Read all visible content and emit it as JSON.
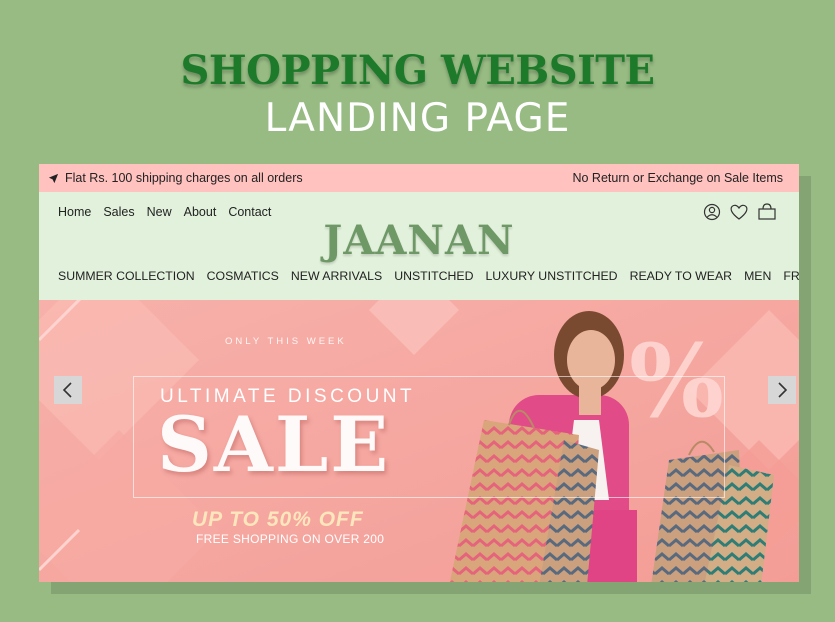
{
  "hero": {
    "title_line1": "SHOPPING WEBSITE",
    "title_line2": "LANDING PAGE"
  },
  "topbar": {
    "left_text": "Flat Rs. 100 shipping charges on all orders",
    "right_text": "No Return or Exchange on Sale Items"
  },
  "nav": {
    "links": [
      "Home",
      "Sales",
      "New",
      "About",
      "Contact"
    ]
  },
  "brand": {
    "name": "JAANAN"
  },
  "categories": [
    "SUMMER COLLECTION",
    "COSMATICS",
    "NEW ARRIVALS",
    "UNSTITCHED",
    "LUXURY UNSTITCHED",
    "READY TO WEAR",
    "MEN",
    "FRAGRANCES"
  ],
  "header_icons": [
    "user-icon",
    "heart-icon",
    "shopping-bag-icon"
  ],
  "banner": {
    "kicker": "ONLY THIS WEEK",
    "subtitle": "ULTIMATE DISCOUNT",
    "headline": "SALE",
    "offer": "UP TO 50% OFF",
    "note": "FREE SHOPPING ON OVER 200",
    "percent_sign": "%"
  },
  "colors": {
    "page_bg": "#97bb83",
    "title_green": "#1c7a2a",
    "topbar_pink": "#ffc2bf",
    "header_green": "#e2f1dc",
    "brand_green": "#6e9866",
    "banner_pink": "#f7a8a2"
  }
}
